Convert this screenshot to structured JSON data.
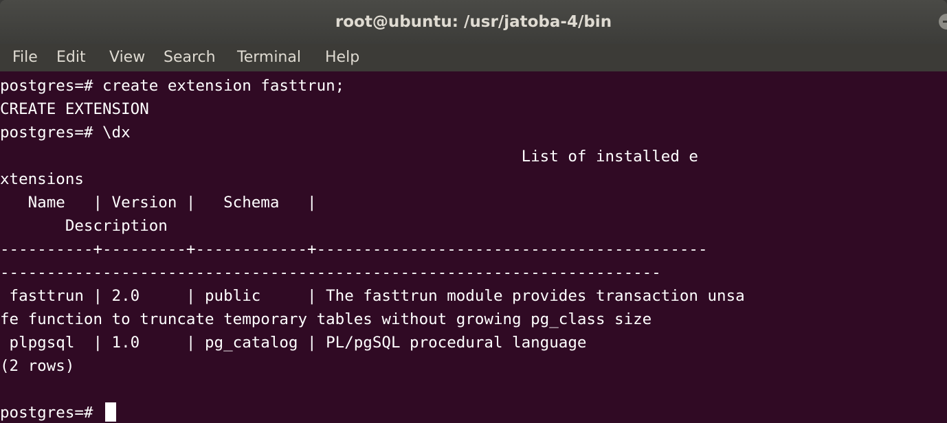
{
  "window": {
    "title": "root@ubuntu: /usr/jatoba-4/bin",
    "controls": {
      "minimize_icon": "minimize-icon",
      "maximize_icon": "maximize-icon",
      "close_icon": "close-icon",
      "close_color": "#e95420"
    }
  },
  "menubar": {
    "items": [
      {
        "label": "File"
      },
      {
        "label": "Edit"
      },
      {
        "label": "View"
      },
      {
        "label": "Search"
      },
      {
        "label": "Terminal"
      },
      {
        "label": "Help"
      }
    ]
  },
  "terminal": {
    "background": "#300a24",
    "lines": [
      "postgres=# create extension fasttrun;",
      "CREATE EXTENSION",
      "postgres=# \\dx",
      "                                                        List of installed e",
      "xtensions",
      "   Name   | Version |   Schema   |",
      "       Description",
      "----------+---------+------------+------------------------------------------",
      "-----------------------------------------------------------------------",
      " fasttrun | 2.0     | public     | The fasttrun module provides transaction unsa",
      "fe function to truncate temporary tables without growing pg_class size",
      " plpgsql  | 1.0     | pg_catalog | PL/pgSQL procedural language",
      "(2 rows)",
      "",
      "postgres=# "
    ]
  }
}
